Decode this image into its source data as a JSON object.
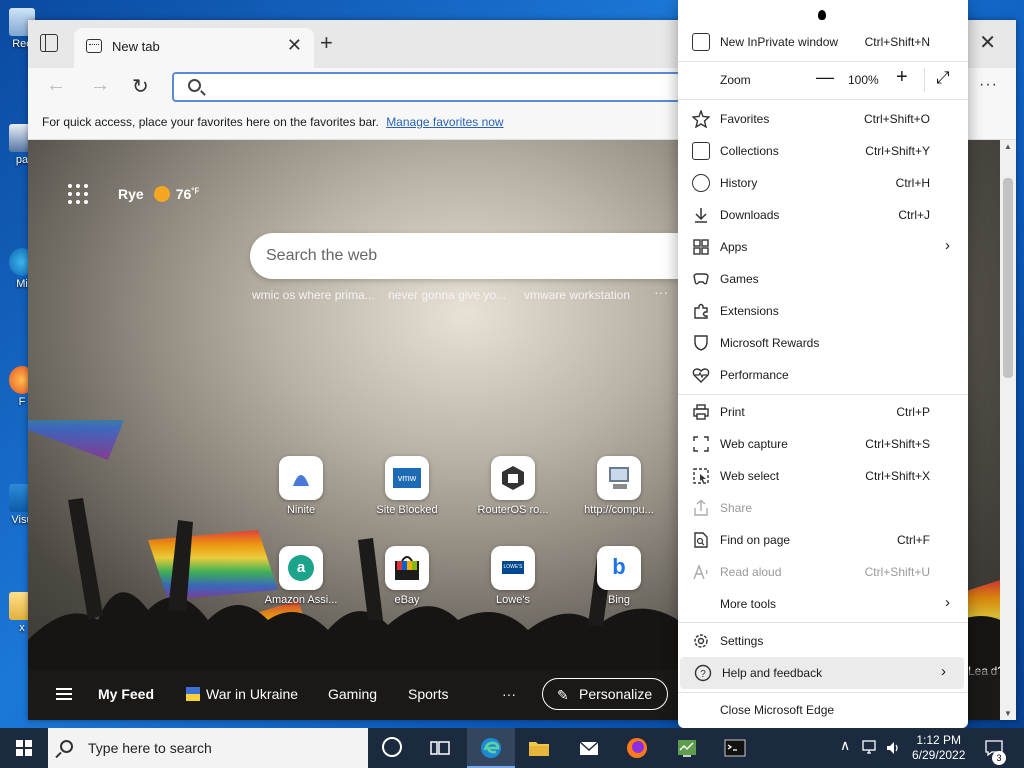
{
  "desktop": {
    "icons": [
      {
        "label": "Rec"
      },
      {
        "label": "pa"
      },
      {
        "label": "Mi"
      },
      {
        "label": "F"
      },
      {
        "label": "Visu"
      },
      {
        "label": "x"
      }
    ]
  },
  "browser": {
    "tab": {
      "title": "New tab",
      "close": "✕"
    },
    "newtab": "+",
    "window_close": "✕",
    "favbar": {
      "text": "For quick access, place your favorites here on the favorites bar.",
      "link": "Manage favorites now"
    },
    "more": "···"
  },
  "newtab_page": {
    "location": "Rye",
    "temperature": "76",
    "temp_unit": "°F",
    "search_placeholder": "Search the web",
    "trending": [
      "wmic os where prima...",
      "never gonna give yo...",
      "vmware workstation"
    ],
    "trending_more": "···",
    "tiles": [
      {
        "label": "Ninite",
        "icon": "ninite-icon"
      },
      {
        "label": "Site Blocked",
        "icon": "vmware-icon",
        "text": "vmw"
      },
      {
        "label": "RouterOS ro...",
        "icon": "routeros-icon"
      },
      {
        "label": "http://compu...",
        "icon": "computer-icon"
      },
      {
        "label": "Amazon Assi...",
        "icon": "amazon-assistant-icon",
        "text": "a"
      },
      {
        "label": "eBay",
        "icon": "ebay-icon"
      },
      {
        "label": "Lowe's",
        "icon": "lowes-icon",
        "text": "LOWE'S"
      },
      {
        "label": "Bing",
        "icon": "bing-icon",
        "text": "b"
      }
    ],
    "feed": {
      "my_feed": "My Feed",
      "items": [
        "War in Ukraine",
        "Gaming",
        "Sports"
      ],
      "more": "···",
      "personalize": "Personalize",
      "side_text_1": "Lea",
      "side_text_2": "d?"
    }
  },
  "menu": {
    "new_inprivate": {
      "label": "New InPrivate window",
      "shortcut": "Ctrl+Shift+N"
    },
    "zoom": {
      "label": "Zoom",
      "minus": "—",
      "value": "100%",
      "plus": "+"
    },
    "items_group1": [
      {
        "label": "Favorites",
        "shortcut": "Ctrl+Shift+O",
        "icon": "favorites-icon"
      },
      {
        "label": "Collections",
        "shortcut": "Ctrl+Shift+Y",
        "icon": "collections-icon"
      },
      {
        "label": "History",
        "shortcut": "Ctrl+H",
        "icon": "history-icon"
      },
      {
        "label": "Downloads",
        "shortcut": "Ctrl+J",
        "icon": "downloads-icon"
      },
      {
        "label": "Apps",
        "shortcut": "",
        "icon": "apps-icon",
        "arrow": "›"
      },
      {
        "label": "Games",
        "shortcut": "",
        "icon": "games-icon"
      },
      {
        "label": "Extensions",
        "shortcut": "",
        "icon": "extensions-icon"
      },
      {
        "label": "Microsoft Rewards",
        "shortcut": "",
        "icon": "rewards-icon"
      },
      {
        "label": "Performance",
        "shortcut": "",
        "icon": "performance-icon"
      }
    ],
    "items_group2": [
      {
        "label": "Print",
        "shortcut": "Ctrl+P",
        "icon": "print-icon"
      },
      {
        "label": "Web capture",
        "shortcut": "Ctrl+Shift+S",
        "icon": "web-capture-icon"
      },
      {
        "label": "Web select",
        "shortcut": "Ctrl+Shift+X",
        "icon": "web-select-icon"
      },
      {
        "label": "Share",
        "shortcut": "",
        "icon": "share-icon",
        "disabled": true
      },
      {
        "label": "Find on page",
        "shortcut": "Ctrl+F",
        "icon": "find-icon"
      },
      {
        "label": "Read aloud",
        "shortcut": "Ctrl+Shift+U",
        "icon": "read-aloud-icon",
        "disabled": true
      },
      {
        "label": "More tools",
        "shortcut": "",
        "icon": "",
        "arrow": "›"
      }
    ],
    "settings": {
      "label": "Settings"
    },
    "help": {
      "label": "Help and feedback",
      "arrow": "›"
    },
    "close": {
      "label": "Close Microsoft Edge"
    }
  },
  "taskbar": {
    "search_placeholder": "Type here to search",
    "time": "1:12 PM",
    "date": "6/29/2022",
    "notification_count": "3",
    "tray_arrow": "∧"
  },
  "colors": {
    "accent": "#2a62b5",
    "menu_highlight": "#ebebeb",
    "taskbar": "#1b2a3e"
  }
}
